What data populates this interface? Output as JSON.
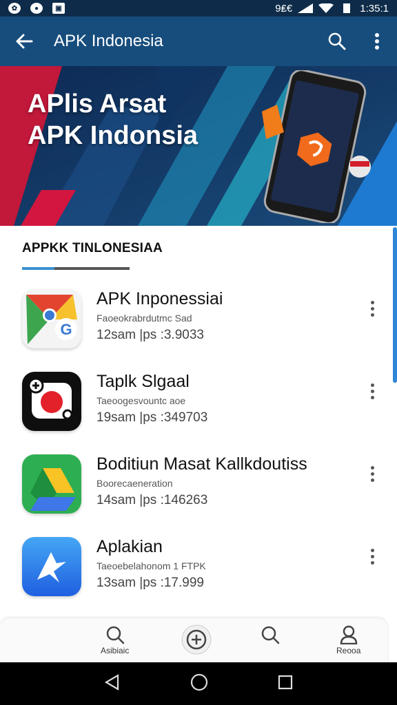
{
  "status_bar": {
    "time": "1:35:1",
    "network": "9₤€"
  },
  "app_bar": {
    "title": "APK Indonesia"
  },
  "banner": {
    "line1": "APlis Arsat",
    "line2": "APK Indonsia"
  },
  "section": {
    "title": "APPKK TINLONESIAA"
  },
  "apps": [
    {
      "name": "APK Inponessiai",
      "subtitle": "Faoeokrabrdutmc Sad",
      "meta": "12sam |ps :3.9033"
    },
    {
      "name": "Taplk Slgaal",
      "subtitle": "Taeoogesvountc aoe",
      "meta": "19sam |ps :349703"
    },
    {
      "name": "Boditiun Masat Kallkdoutiss",
      "subtitle": "Boorecaeneration",
      "meta": "14sam |ps :146263"
    },
    {
      "name": "Aplakian",
      "subtitle": "Taeoebelahonom 1 FTPK",
      "meta": "13sam |ps :17.999"
    }
  ],
  "bottom_nav": {
    "left_label": "Asibiaic",
    "right_label": "Reooa"
  },
  "colors": {
    "app_bar": "#174d7c",
    "accent": "#2f86d6"
  }
}
